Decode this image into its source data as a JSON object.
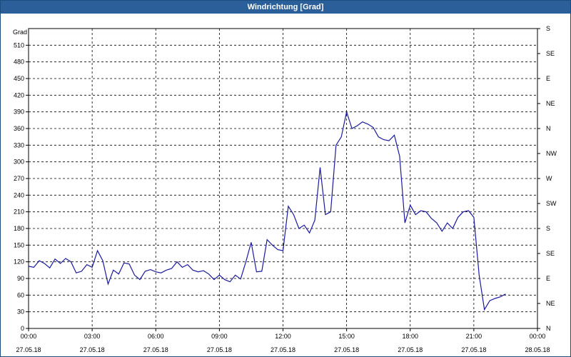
{
  "window": {
    "title": "Windrichtung [Grad]"
  },
  "chart_data": {
    "type": "line",
    "title": "Windrichtung [Grad]",
    "ylabel": "Grad",
    "ylim": [
      0,
      540
    ],
    "y_ticks": [
      0,
      30,
      60,
      90,
      120,
      150,
      180,
      210,
      240,
      270,
      300,
      330,
      360,
      390,
      420,
      450,
      480,
      510
    ],
    "right_axis_labels": [
      "N",
      "NE",
      "E",
      "SE",
      "S",
      "SW",
      "W",
      "NW",
      "N",
      "NE",
      "E",
      "SE",
      "S"
    ],
    "xlim_hours": [
      0,
      24
    ],
    "x_ticks": [
      {
        "time": "00:00",
        "date": "27.05.18"
      },
      {
        "time": "03:00",
        "date": "27.05.18"
      },
      {
        "time": "06:00",
        "date": "27.05.18"
      },
      {
        "time": "09:00",
        "date": "27.05.18"
      },
      {
        "time": "12:00",
        "date": "27.05.18"
      },
      {
        "time": "15:00",
        "date": "27.05.18"
      },
      {
        "time": "18:00",
        "date": "27.05.18"
      },
      {
        "time": "21:00",
        "date": "27.05.18"
      },
      {
        "time": "00:00",
        "date": "28.05.18"
      }
    ],
    "grid": true,
    "line_color": "#1a1aa0",
    "series": [
      {
        "x_hours": [
          0,
          0.25,
          0.5,
          0.75,
          1.0,
          1.25,
          1.5,
          1.75,
          2.0,
          2.25,
          2.5,
          2.75,
          3.0,
          3.25,
          3.5,
          3.75,
          4.0,
          4.25,
          4.5,
          4.75,
          5.0,
          5.25,
          5.5,
          5.75,
          6.0,
          6.25,
          6.5,
          6.75,
          7.0,
          7.25,
          7.5,
          7.75,
          8.0,
          8.25,
          8.5,
          8.75,
          9.0,
          9.25,
          9.5,
          9.75,
          10.0,
          10.25,
          10.5,
          10.75,
          11.0,
          11.25,
          11.5,
          11.75,
          12.0,
          12.25,
          12.5,
          12.75,
          13.0,
          13.25,
          13.5,
          13.75,
          14.0,
          14.25,
          14.5,
          14.75,
          15.0,
          15.25,
          15.5,
          15.75,
          16.0,
          16.25,
          16.5,
          16.75,
          17.0,
          17.25,
          17.5,
          17.75,
          18.0,
          18.25,
          18.5,
          18.75,
          19.0,
          19.25,
          19.5,
          19.75,
          20.0,
          20.25,
          20.5,
          20.75,
          21.0,
          21.25,
          21.5,
          21.75,
          22.0,
          22.25,
          22.5,
          22.75,
          23.0,
          23.25,
          23.5,
          23.75,
          24.0
        ],
        "values": [
          112,
          110,
          122,
          117,
          109,
          125,
          117,
          126,
          120,
          100,
          103,
          115,
          110,
          140,
          122,
          80,
          105,
          98,
          118,
          116,
          96,
          88,
          103,
          106,
          102,
          100,
          105,
          108,
          120,
          110,
          115,
          105,
          102,
          104,
          98,
          88,
          96,
          88,
          84,
          96,
          89,
          120,
          155,
          102,
          103,
          160,
          150,
          142,
          140,
          220,
          205,
          180,
          186,
          172,
          195,
          290,
          205,
          210,
          330,
          345,
          390,
          360,
          365,
          372,
          368,
          362,
          345,
          340,
          338,
          348,
          310,
          190,
          222,
          205,
          212,
          210,
          198,
          190,
          175,
          190,
          180,
          200,
          210,
          212,
          200,
          96,
          34,
          50,
          54,
          57,
          62
        ]
      }
    ]
  }
}
